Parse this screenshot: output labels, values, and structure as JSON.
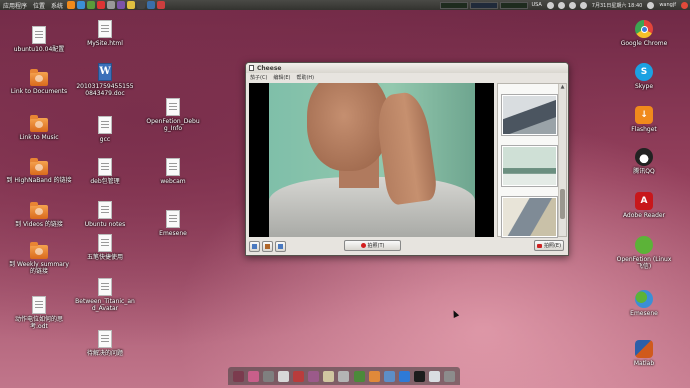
{
  "panel": {
    "menus": [
      "应用程序",
      "位置",
      "系统"
    ],
    "username": "wangjf",
    "datetime": "7月31日星期六 18:40",
    "keyboard": "USA"
  },
  "desktop_left": [
    {
      "label": "ubuntu10.04配置",
      "kind": "doc"
    },
    {
      "label": "MySite.html",
      "kind": "doc"
    },
    {
      "label": "Link to Documents",
      "kind": "folder"
    },
    {
      "label": "2010317594551550843479.doc",
      "kind": "wdoc"
    },
    {
      "label": "OpenFetion_Debug_Info",
      "kind": "doc"
    },
    {
      "label": "Link to Music",
      "kind": "folder"
    },
    {
      "label": "gcc",
      "kind": "doc"
    },
    {
      "label": "到 HighNaBand 的链接",
      "kind": "folder"
    },
    {
      "label": "deb包管理",
      "kind": "doc"
    },
    {
      "label": "webcam",
      "kind": "doc"
    },
    {
      "label": "到 Videos 的链接",
      "kind": "folder"
    },
    {
      "label": "Ubuntu notes",
      "kind": "doc"
    },
    {
      "label": "Emesene",
      "kind": "doc"
    },
    {
      "label": "五笔快捷使用",
      "kind": "doc"
    },
    {
      "label": "到 Weekly summary 的链接",
      "kind": "folder"
    },
    {
      "label": "Between_Titanic_and_Avatar",
      "kind": "doc"
    },
    {
      "label": "动作电位如何的思考.odt",
      "kind": "doc"
    },
    {
      "label": "待解决的问题",
      "kind": "doc"
    }
  ],
  "desktop_right": [
    {
      "label": "Google Chrome",
      "color": "#e2443a"
    },
    {
      "label": "Skype",
      "color": "#1ba1e2"
    },
    {
      "label": "Flashget",
      "color": "#f08a1c"
    },
    {
      "label": "腾讯QQ",
      "color": "#222222"
    },
    {
      "label": "Adobe Reader",
      "color": "#c8171b"
    },
    {
      "label": "OpenFetion (Linux 飞信)",
      "color": "#5cb338"
    },
    {
      "label": "Emesene",
      "color": "#3b8fd6"
    },
    {
      "label": "Matlab",
      "color": "#d05a1c"
    }
  ],
  "window": {
    "title": "Cheese",
    "menus": [
      "茄子(C)",
      "编辑(E)",
      "帮助(H)"
    ],
    "take_photo_label": "拍照(T)",
    "leave_label": "拍照(E)"
  }
}
